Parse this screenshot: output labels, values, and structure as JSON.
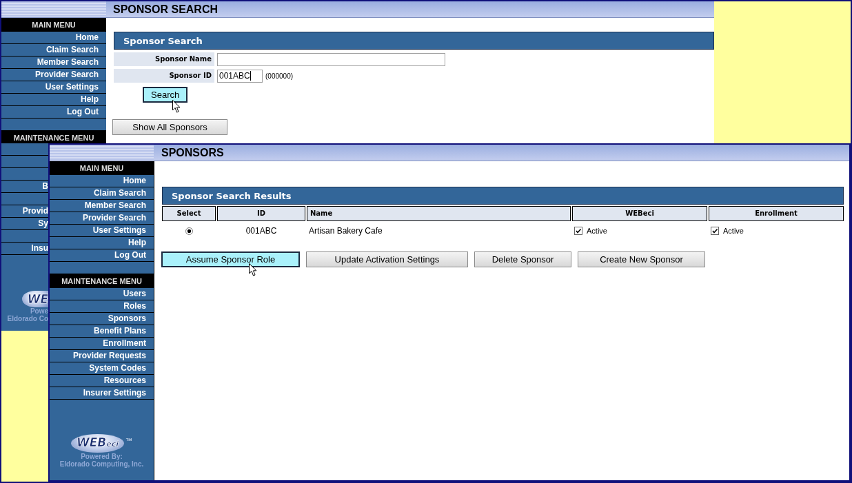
{
  "back_screen": {
    "title": "SPONSOR SEARCH",
    "main_menu": {
      "title": "MAIN MENU",
      "items": [
        {
          "label": "Home"
        },
        {
          "label": "Claim Search"
        },
        {
          "label": "Member Search"
        },
        {
          "label": "Provider Search"
        },
        {
          "label": "User Settings"
        },
        {
          "label": "Help"
        },
        {
          "label": "Log Out"
        }
      ]
    },
    "maintenance_menu": {
      "title": "MAINTENANCE MENU",
      "items": [
        {
          "kind": "covered"
        },
        {
          "kind": "covered"
        },
        {
          "kind": "covered"
        },
        {
          "kind": "text",
          "label": "B"
        },
        {
          "kind": "covered"
        },
        {
          "kind": "text",
          "label": "Provid"
        },
        {
          "kind": "text",
          "label": "Sy"
        },
        {
          "kind": "covered"
        },
        {
          "kind": "text",
          "label": "Insu"
        }
      ]
    },
    "logo": {
      "mark": "WE",
      "powered_by": "Powe",
      "company": "Eldorado Co"
    },
    "panel": {
      "title": "Sponsor Search",
      "fields": [
        {
          "label": "Sponsor Name",
          "focused": false
        },
        {
          "label": "Sponsor ID",
          "value": "001ABC",
          "hint": "(000000)",
          "focused": true
        }
      ]
    },
    "buttons": [
      {
        "label": "Search",
        "kind": "primary",
        "hovered": true
      },
      {
        "label": "Show All Sponsors",
        "kind": "secondary",
        "hovered": false
      }
    ]
  },
  "front_screen": {
    "title": "SPONSORS",
    "main_menu": {
      "title": "MAIN MENU",
      "items": [
        {
          "label": "Home"
        },
        {
          "label": "Claim Search"
        },
        {
          "label": "Member Search"
        },
        {
          "label": "Provider Search"
        },
        {
          "label": "User Settings"
        },
        {
          "label": "Help"
        },
        {
          "label": "Log Out"
        }
      ]
    },
    "maintenance_menu": {
      "title": "MAINTENANCE MENU",
      "items": [
        {
          "label": "Users"
        },
        {
          "label": "Roles"
        },
        {
          "label": "Sponsors"
        },
        {
          "label": "Benefit Plans"
        },
        {
          "label": "Enrollment"
        },
        {
          "label": "Provider Requests"
        },
        {
          "label": "System Codes"
        },
        {
          "label": "Resources"
        },
        {
          "label": "Insurer Settings"
        }
      ]
    },
    "logo": {
      "mark": "WEB",
      "mark_suffix": "eci",
      "trademark": "™",
      "powered_by": "Powered By:",
      "company": "Eldorado Computing, Inc."
    },
    "results": {
      "title": "Sponsor Search Results",
      "columns": [
        "Select",
        "ID",
        "Name",
        "WEBeci",
        "Enrollment"
      ],
      "rows": [
        {
          "selected": true,
          "id": "001ABC",
          "name": "Artisan Bakery Cafe",
          "webeci": {
            "checked": true,
            "label": "Active"
          },
          "enrollment": {
            "checked": true,
            "label": "Active"
          }
        }
      ]
    },
    "buttons": [
      {
        "label": "Assume Sponsor Role",
        "kind": "primary",
        "hovered": true
      },
      {
        "label": "Update Activation Settings",
        "kind": "secondary",
        "hovered": false
      },
      {
        "label": "Delete Sponsor",
        "kind": "secondary",
        "hovered": false
      },
      {
        "label": "Create New Sponsor",
        "kind": "secondary",
        "hovered": false
      }
    ]
  }
}
